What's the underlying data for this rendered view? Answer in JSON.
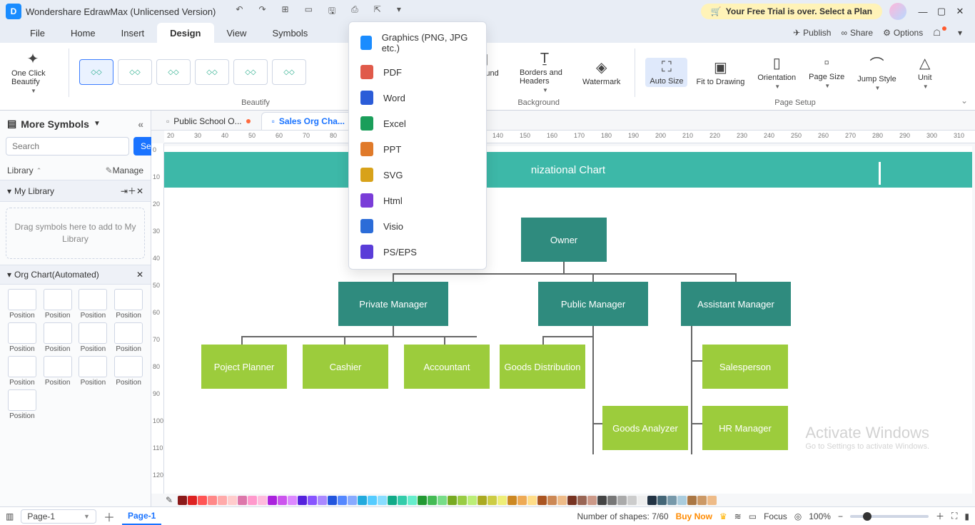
{
  "app": {
    "title": "Wondershare EdrawMax (Unlicensed Version)"
  },
  "trial": {
    "text": "Your Free Trial is over. Select a Plan"
  },
  "menu": {
    "items": [
      "File",
      "Home",
      "Insert",
      "Design",
      "View",
      "Symbols"
    ],
    "active": "Design",
    "right": {
      "publish": "Publish",
      "share": "Share",
      "options": "Options"
    }
  },
  "ribbon": {
    "oneclick": "One Click Beautify",
    "beautify_label": "Beautify",
    "background_label": "Background",
    "page_setup_label": "Page Setup",
    "bg_picture": "Background Picture",
    "borders": "Borders and Headers",
    "watermark": "Watermark",
    "auto_size": "Auto Size",
    "fit": "Fit to Drawing",
    "orientation": "Orientation",
    "page_size": "Page Size",
    "jump_style": "Jump Style",
    "unit": "Unit"
  },
  "export_menu": [
    "Graphics (PNG, JPG etc.)",
    "PDF",
    "Word",
    "Excel",
    "PPT",
    "SVG",
    "Html",
    "Visio",
    "PS/EPS"
  ],
  "export_colors": [
    "#1a8cff",
    "#e05a4a",
    "#2b5cd8",
    "#1a9e5a",
    "#e07a2a",
    "#d8a21a",
    "#7a3dd8",
    "#2b6cd8",
    "#5a3dd8"
  ],
  "sidebar": {
    "title": "More Symbols",
    "search_btn": "Search",
    "search_ph": "Search",
    "library": "Library",
    "manage": "Manage",
    "my_library": "My Library",
    "drop_hint": "Drag symbols here to add to My Library",
    "org_section": "Org Chart(Automated)",
    "shape_label": "Position"
  },
  "docs": {
    "tab1": "Public School O...",
    "tab2": "Sales Org Cha..."
  },
  "chart": {
    "title_suffix": "nizational Chart",
    "owner": "Owner",
    "private_mgr": "Private Manager",
    "public_mgr": "Public Manager",
    "asst_mgr": "Assistant Manager",
    "planner": "Poject Planner",
    "cashier": "Cashier",
    "accountant": "Accountant",
    "goods_dist": "Goods Distribution",
    "salesperson": "Salesperson",
    "goods_analyzer": "Goods Analyzer",
    "hr": "HR Manager"
  },
  "status": {
    "page_dropdown": "Page-1",
    "page_tab": "Page-1",
    "shapes": "Number of shapes: 7/60",
    "buy": "Buy Now",
    "focus": "Focus",
    "zoom": "100%"
  },
  "watermark": {
    "l1": "Activate Windows",
    "l2": "Go to Settings to activate Windows."
  },
  "ruler_start": 140,
  "color_strip": [
    "#8b1a1a",
    "#d22",
    "#f55",
    "#f88",
    "#faa",
    "#fcc",
    "#d7a",
    "#f9c",
    "#fbd",
    "#a2d",
    "#c5e",
    "#d8f",
    "#52d",
    "#85f",
    "#a8f",
    "#25d",
    "#58f",
    "#8af",
    "#2ad",
    "#5cf",
    "#8df",
    "#1a8",
    "#3ca",
    "#6ec",
    "#293",
    "#4b5",
    "#7d8",
    "#7a2",
    "#9c4",
    "#be7",
    "#aa2",
    "#cc4",
    "#ee7",
    "#c82",
    "#ea5",
    "#fd8",
    "#a52",
    "#c85",
    "#eb8",
    "#732",
    "#965",
    "#c98",
    "#444",
    "#777",
    "#aaa",
    "#ccc",
    "#eee",
    "#234",
    "#467",
    "#79a",
    "#acd",
    "#a74",
    "#c96",
    "#eb8"
  ]
}
